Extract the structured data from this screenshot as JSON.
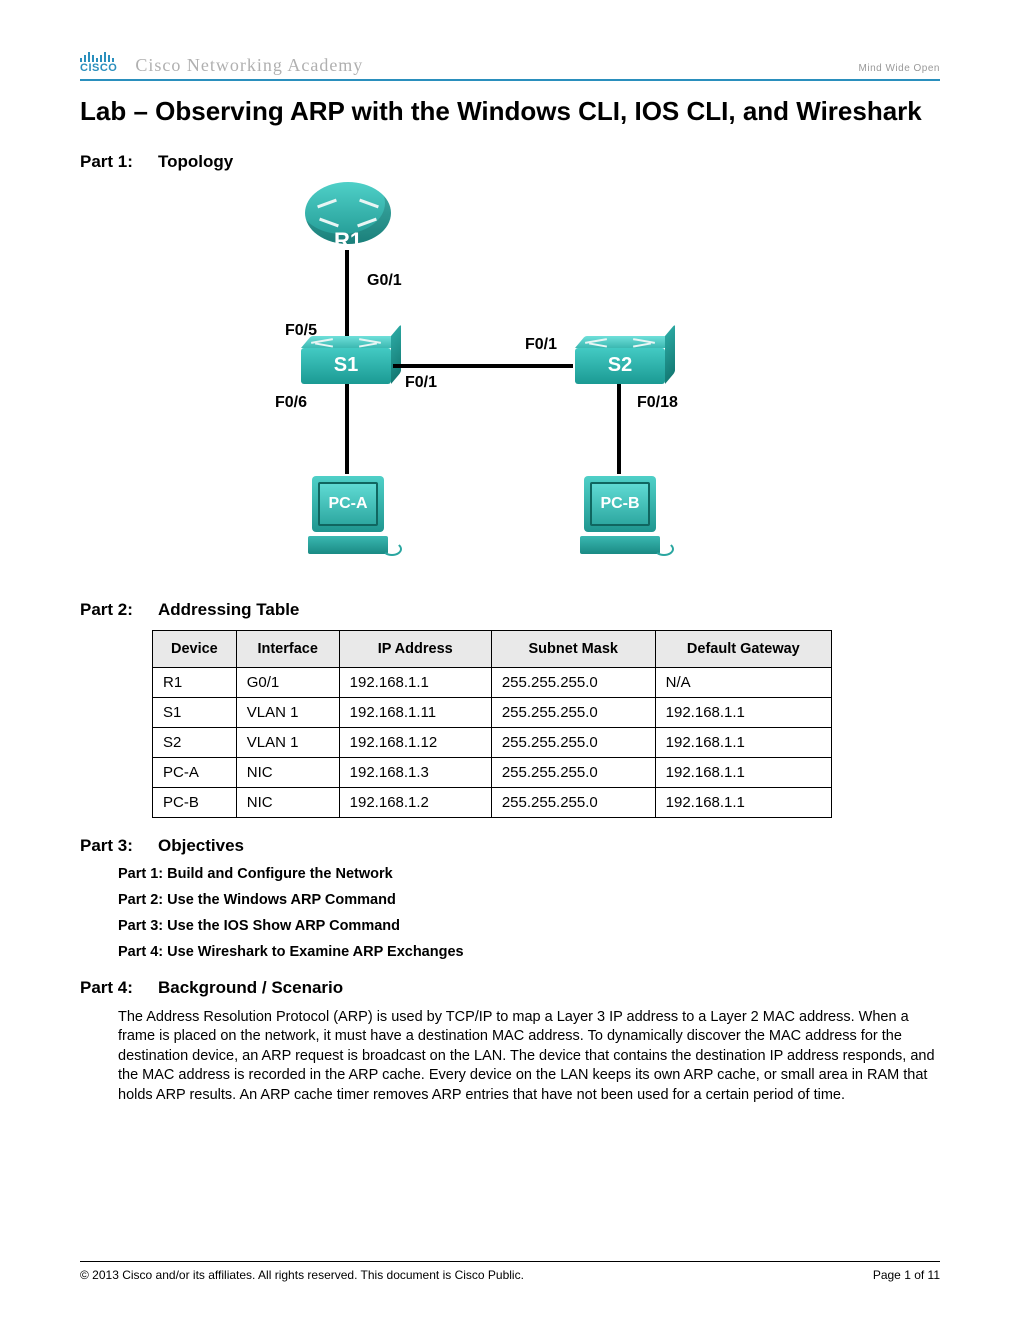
{
  "header": {
    "logo_text": "CISCO",
    "academy": "Cisco Networking Academy",
    "tagline": "Mind Wide Open"
  },
  "title": "Lab – Observing ARP with the Windows CLI, IOS CLI, and Wireshark",
  "part1": {
    "num": "Part 1:",
    "title": "Topology"
  },
  "topology": {
    "devices": {
      "r1": "R1",
      "s1": "S1",
      "s2": "S2",
      "pca": "PC-A",
      "pcb": "PC-B"
    },
    "labels": {
      "r1_g01": "G0/1",
      "s1_f05": "F0/5",
      "s1_f01_out": "F0/1",
      "s2_f01": "F0/1",
      "s1_f06": "F0/6",
      "s2_f018": "F0/18"
    }
  },
  "part2": {
    "num": "Part 2:",
    "title": "Addressing Table"
  },
  "table": {
    "headers": [
      "Device",
      "Interface",
      "IP Address",
      "Subnet Mask",
      "Default Gateway"
    ],
    "rows": [
      [
        "R1",
        "G0/1",
        "192.168.1.1",
        "255.255.255.0",
        "N/A"
      ],
      [
        "S1",
        "VLAN 1",
        "192.168.1.11",
        "255.255.255.0",
        "192.168.1.1"
      ],
      [
        "S2",
        "VLAN 1",
        "192.168.1.12",
        "255.255.255.0",
        "192.168.1.1"
      ],
      [
        "PC-A",
        "NIC",
        "192.168.1.3",
        "255.255.255.0",
        "192.168.1.1"
      ],
      [
        "PC-B",
        "NIC",
        "192.168.1.2",
        "255.255.255.0",
        "192.168.1.1"
      ]
    ]
  },
  "part3": {
    "num": "Part 3:",
    "title": "Objectives"
  },
  "objectives": [
    "Part 1: Build and Configure the Network",
    "Part 2: Use the Windows ARP Command",
    "Part 3: Use the IOS Show ARP Command",
    "Part 4: Use Wireshark to Examine ARP Exchanges"
  ],
  "part4": {
    "num": "Part 4:",
    "title": "Background / Scenario"
  },
  "background_para": "The Address Resolution Protocol (ARP) is used by TCP/IP to map a Layer 3 IP address to a Layer 2 MAC address. When a frame is placed on the network, it must have a destination MAC address. To dynamically discover the MAC address for the destination device, an ARP request is broadcast on the LAN. The device that contains the destination IP address responds, and the MAC address is recorded in the ARP cache. Every device on the LAN keeps its own ARP cache, or small area in RAM that holds ARP results. An ARP cache timer removes ARP entries that have not been used for a certain period of time.",
  "footer": {
    "copyright": "© 2013 Cisco and/or its affiliates. All rights reserved. This document is Cisco Public.",
    "page": "Page 1 of 11"
  }
}
